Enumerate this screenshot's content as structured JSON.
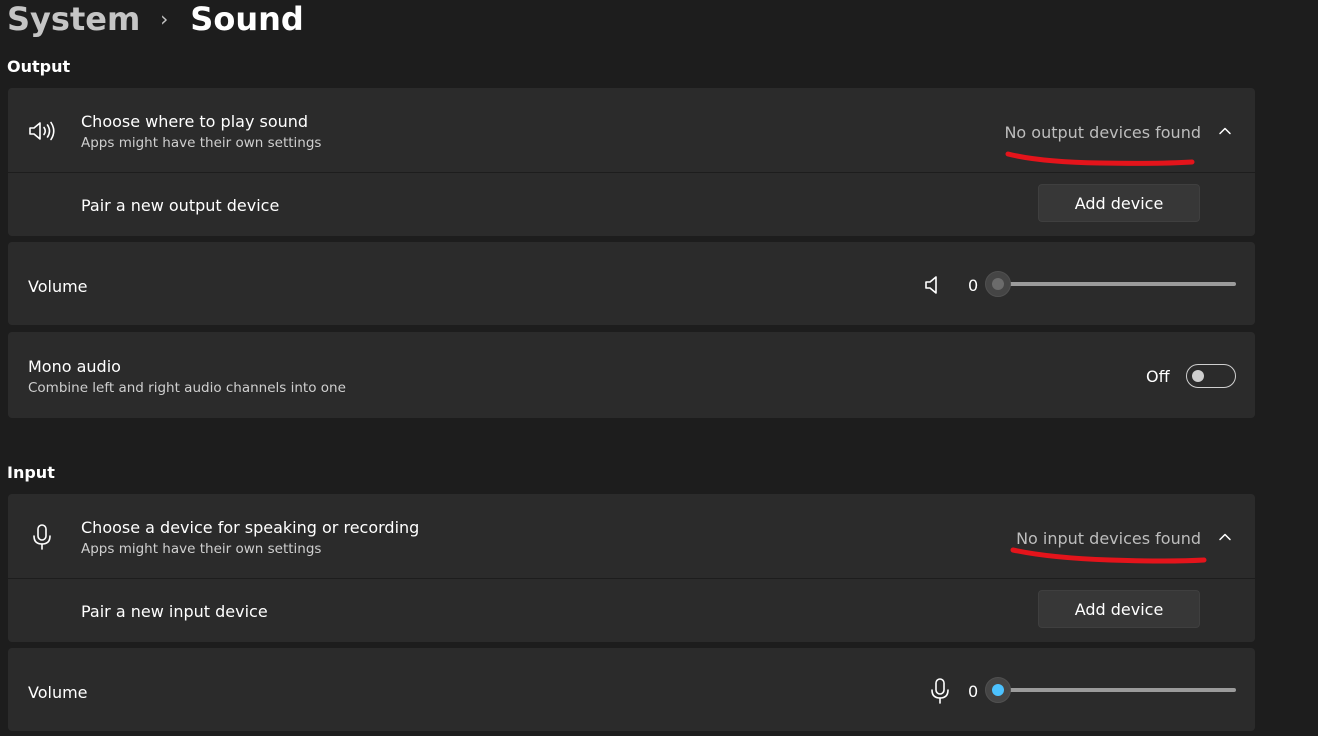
{
  "breadcrumb": {
    "parent": "System",
    "separator": "›",
    "current": "Sound"
  },
  "output": {
    "section_label": "Output",
    "choose": {
      "title": "Choose where to play sound",
      "subtitle": "Apps might have their own settings",
      "status": "No output devices found",
      "icon": "speaker-icon"
    },
    "pair": {
      "label": "Pair a new output device",
      "button": "Add device"
    },
    "volume": {
      "label": "Volume",
      "value": "0",
      "level_percent": 0,
      "icon": "speaker-muted-icon"
    },
    "mono": {
      "title": "Mono audio",
      "subtitle": "Combine left and right audio channels into one",
      "state_label": "Off",
      "enabled": false
    }
  },
  "input": {
    "section_label": "Input",
    "choose": {
      "title": "Choose a device for speaking or recording",
      "subtitle": "Apps might have their own settings",
      "status": "No input devices found",
      "icon": "microphone-icon"
    },
    "pair": {
      "label": "Pair a new input device",
      "button": "Add device"
    },
    "volume": {
      "label": "Volume",
      "value": "0",
      "level_percent": 0,
      "icon": "microphone-icon"
    }
  },
  "colors": {
    "accent": "#4cc2ff",
    "annotation": "#e4141b",
    "card": "#2b2b2b",
    "background": "#1d1d1d"
  }
}
